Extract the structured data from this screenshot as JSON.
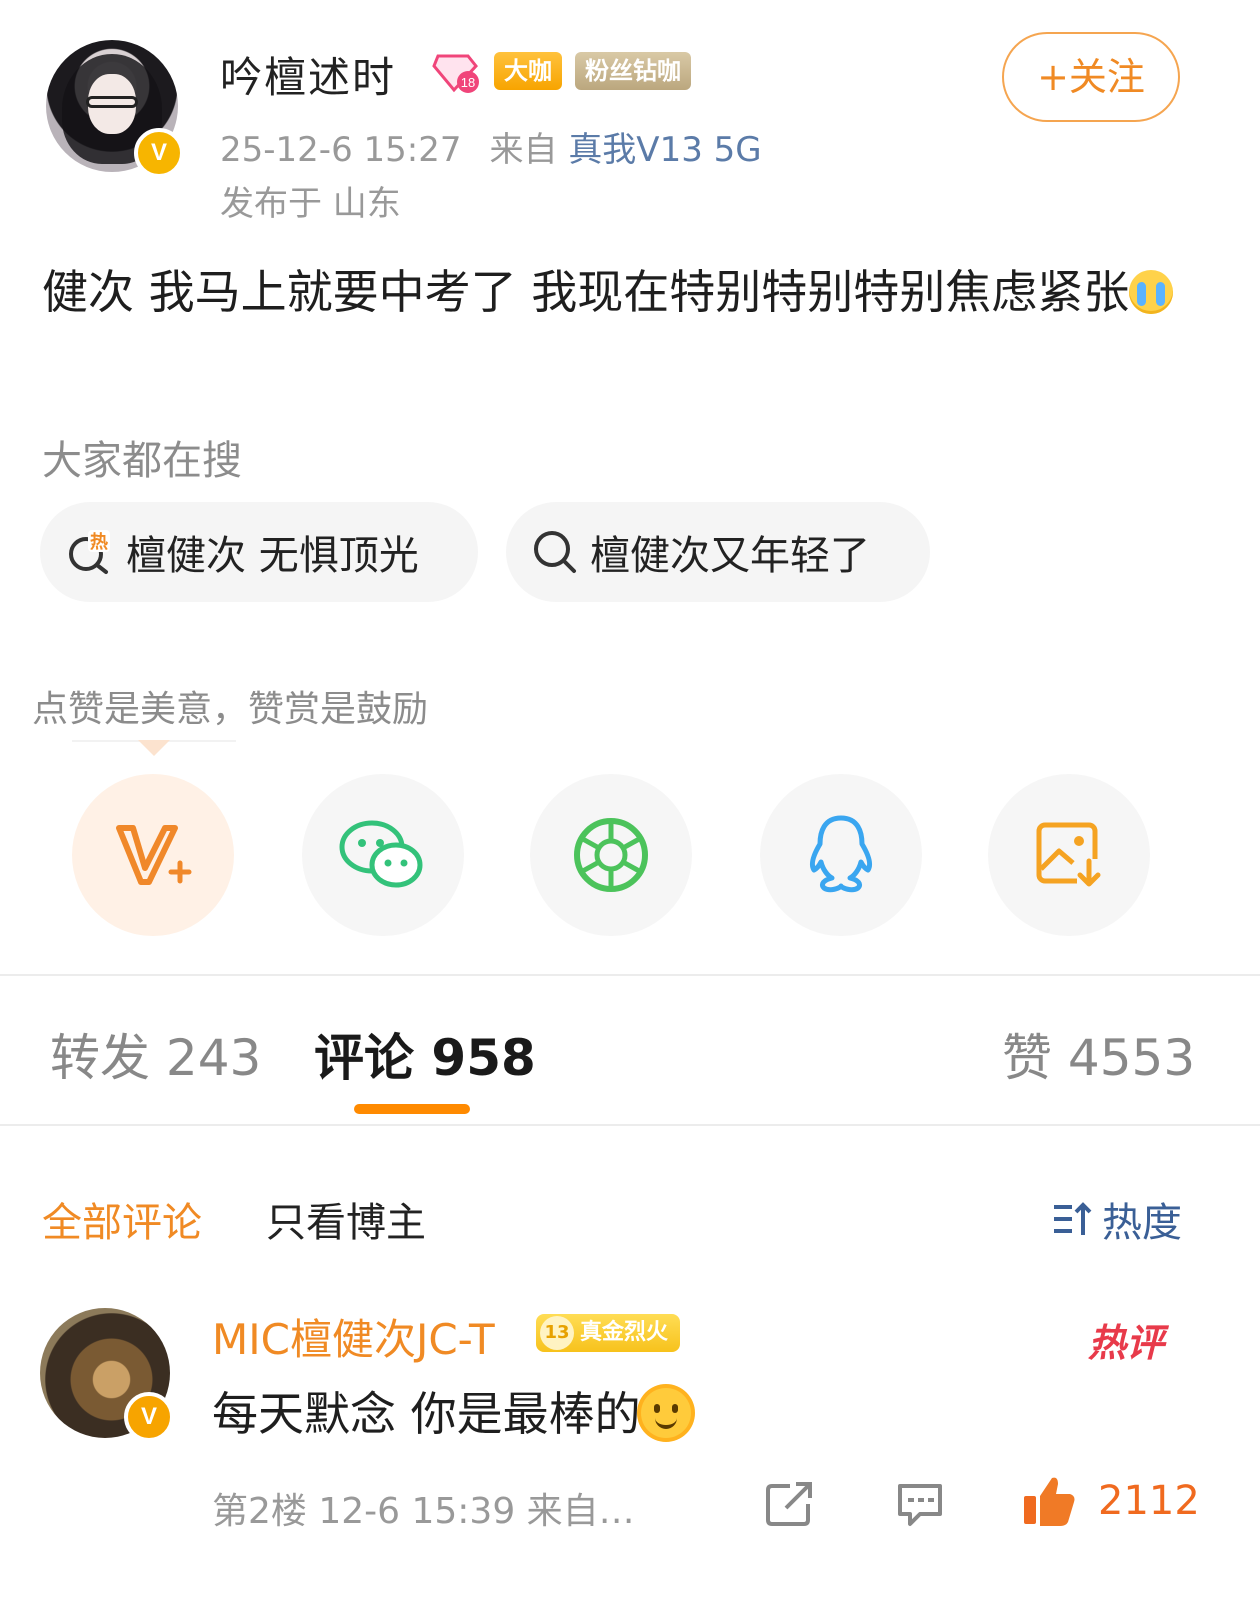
{
  "post": {
    "username": "吟檀述时",
    "tags": {
      "daka": "大咖",
      "fans": "粉丝钻咖"
    },
    "follow_label": "+关注",
    "time": "25-12-6 15:27",
    "from_label": "来自",
    "device": "真我V13 5G",
    "ip_location": "发布于 山东",
    "text": "健次 我马上就要中考了 我现在特别特别特别焦虑紧张",
    "text_emoji": "crying-face-emoji"
  },
  "search": {
    "hint": "大家都在搜",
    "chips": [
      "檀健次 无惧顶光",
      "檀健次又年轻了"
    ]
  },
  "reward": {
    "hint": "点赞是美意，赞赏是鼓励"
  },
  "share_targets": [
    {
      "name": "v-plus-icon",
      "color": "#f0882a"
    },
    {
      "name": "wechat-icon",
      "color": "#33c27a"
    },
    {
      "name": "moments-icon",
      "color": "#4cc35b"
    },
    {
      "name": "qq-icon",
      "color": "#3aa6f0"
    },
    {
      "name": "save-image-icon",
      "color": "#f5a322"
    }
  ],
  "tabs": [
    {
      "label": "转发 243",
      "active": false
    },
    {
      "label": "评论 958",
      "active": true
    },
    {
      "label": "赞 4553",
      "active": false
    }
  ],
  "filter": {
    "all": "全部评论",
    "owner_only": "只看博主",
    "sort": "热度"
  },
  "comment": {
    "username": "MIC檀健次JC-T",
    "badge_level": "13",
    "badge_text": "真金烈火",
    "hot_tag": "热评",
    "text": "每天默念 你是最棒的",
    "meta": "第2楼 12-6 15:39 来自…",
    "likes": "2112"
  },
  "colors": {
    "accent": "#f08a24",
    "link": "#5b7ba8",
    "indicator": "#ff8a00",
    "hot": "#e83a4a"
  }
}
